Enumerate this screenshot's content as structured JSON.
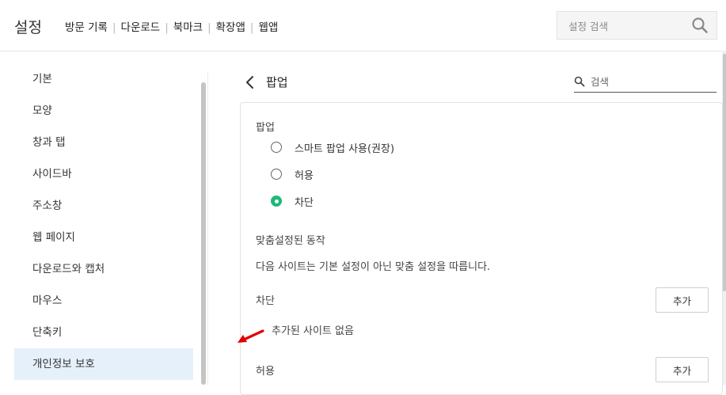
{
  "header": {
    "app_title": "설정",
    "nav": [
      "방문 기록",
      "다운로드",
      "북마크",
      "확장앱",
      "웹앱"
    ],
    "search_placeholder": "설정 검색"
  },
  "sidebar": {
    "items": [
      {
        "label": "기본"
      },
      {
        "label": "모양"
      },
      {
        "label": "창과 탭"
      },
      {
        "label": "사이드바"
      },
      {
        "label": "주소창"
      },
      {
        "label": "웹 페이지"
      },
      {
        "label": "다운로드와 캡처"
      },
      {
        "label": "마우스"
      },
      {
        "label": "단축키"
      },
      {
        "label": "개인정보 보호",
        "active": true
      }
    ]
  },
  "content": {
    "title": "팝업",
    "search_placeholder": "검색",
    "popup_section_label": "팝업",
    "options": [
      {
        "label": "스마트 팝업 사용(권장)",
        "checked": false
      },
      {
        "label": "허용",
        "checked": false
      },
      {
        "label": "차단",
        "checked": true
      }
    ],
    "custom_section_label": "맞춤설정된 동작",
    "custom_description": "다음 사이트는 기본 설정이 아닌 맞춤 설정을 따릅니다.",
    "block_label": "차단",
    "add_label": "추가",
    "block_empty": "추가된 사이트 없음",
    "allow_label": "허용",
    "allow_add_label": "추가"
  },
  "colors": {
    "accent_green": "#1fb87a",
    "active_item_bg": "#e5f0fa",
    "annotation_arrow": "#e00000"
  },
  "icons": [
    "search-icon",
    "back-chevron-icon",
    "magnifier-icon",
    "annotation-arrow"
  ]
}
